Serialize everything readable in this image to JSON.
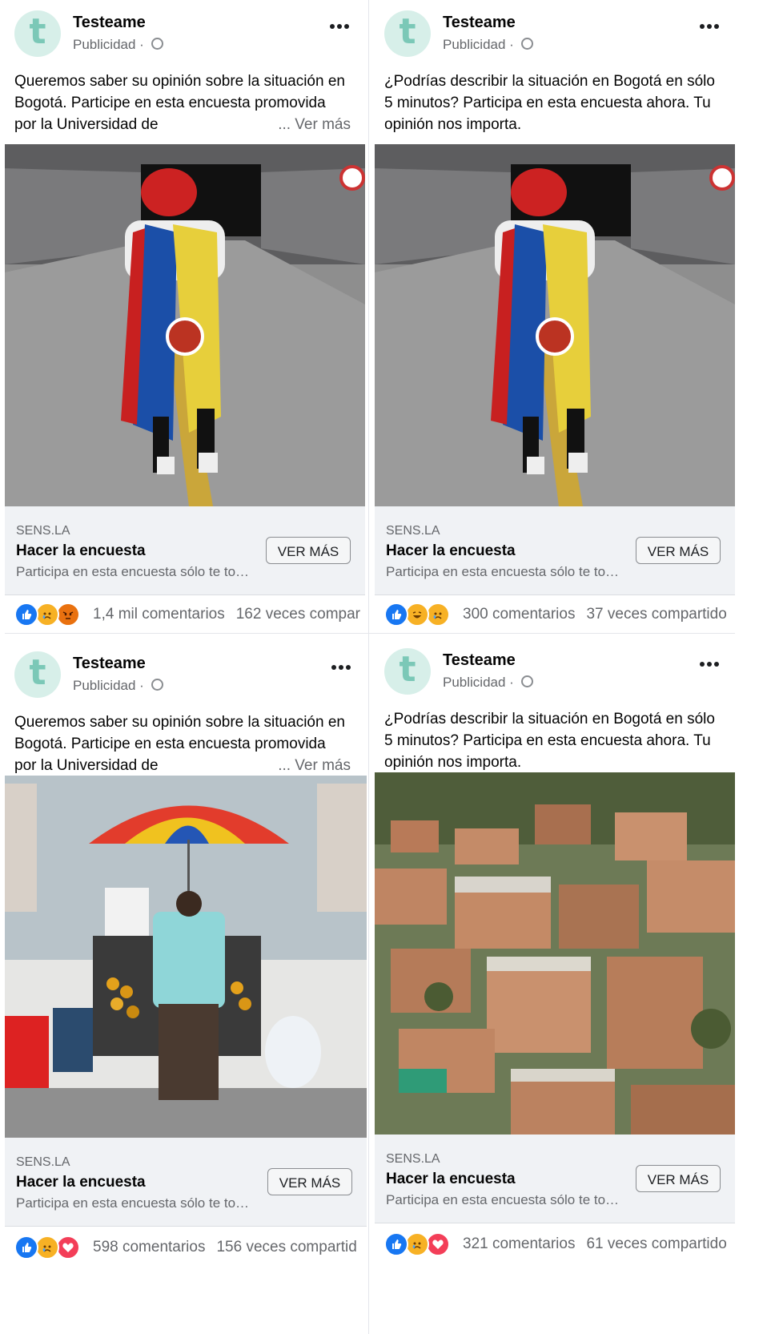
{
  "posts": [
    {
      "page_name": "Testeame",
      "sponsored": "Publicidad",
      "text": "Queremos saber su opinión sobre la situación en Bogotá. Participe en esta encuesta promovida por la Universidad de",
      "see_more": "... Ver más",
      "image": "person-with-colombian-flag-on-road",
      "domain": "SENS.LA",
      "cta_title": "Hacer la encuesta",
      "cta_desc": "Participa en esta encuesta sólo te to…",
      "cta_button": "VER MÁS",
      "reactions": [
        "like",
        "sad",
        "angry"
      ],
      "comments": "1,4 mil comentarios",
      "shares": "162 veces compar"
    },
    {
      "page_name": "Testeame",
      "sponsored": "Publicidad",
      "text": "¿Podrías describir la situación en Bogotá en sólo 5 minutos? Participa en esta encuesta ahora. Tu opinión nos importa.",
      "see_more": "",
      "image": "person-with-colombian-flag-on-road",
      "domain": "SENS.LA",
      "cta_title": "Hacer la encuesta",
      "cta_desc": "Participa en esta encuesta sólo te to…",
      "cta_button": "VER MÁS",
      "reactions": [
        "like",
        "haha",
        "sad"
      ],
      "comments": "300 comentarios",
      "shares": "37 veces compartido"
    },
    {
      "page_name": "Testeame",
      "sponsored": "Publicidad",
      "text": "Queremos saber su opinión sobre la situación en Bogotá. Participe en esta encuesta promovida por la Universidad de",
      "see_more": "... Ver más",
      "image": "street-vendor-with-umbrella",
      "domain": "SENS.LA",
      "cta_title": "Hacer la encuesta",
      "cta_desc": "Participa en esta encuesta sólo te to…",
      "cta_button": "VER MÁS",
      "reactions": [
        "like",
        "sad",
        "love"
      ],
      "comments": "598 comentarios",
      "shares": "156 veces compartid"
    },
    {
      "page_name": "Testeame",
      "sponsored": "Publicidad",
      "text": "¿Podrías describir la situación en Bogotá en sólo 5 minutos? Participa en esta encuesta ahora. Tu opinión nos importa.",
      "see_more": "",
      "image": "hillside-brick-houses",
      "domain": "SENS.LA",
      "cta_title": "Hacer la encuesta",
      "cta_desc": "Participa en esta encuesta sólo te to…",
      "cta_button": "VER MÁS",
      "reactions": [
        "like",
        "sad",
        "love"
      ],
      "comments": "321 comentarios",
      "shares": "61 veces compartido"
    }
  ],
  "colors": {
    "like": "#1877f2",
    "love": "#f33e58",
    "haha": "#f7b125",
    "sad": "#f7b125",
    "angry": "#e9710f"
  }
}
